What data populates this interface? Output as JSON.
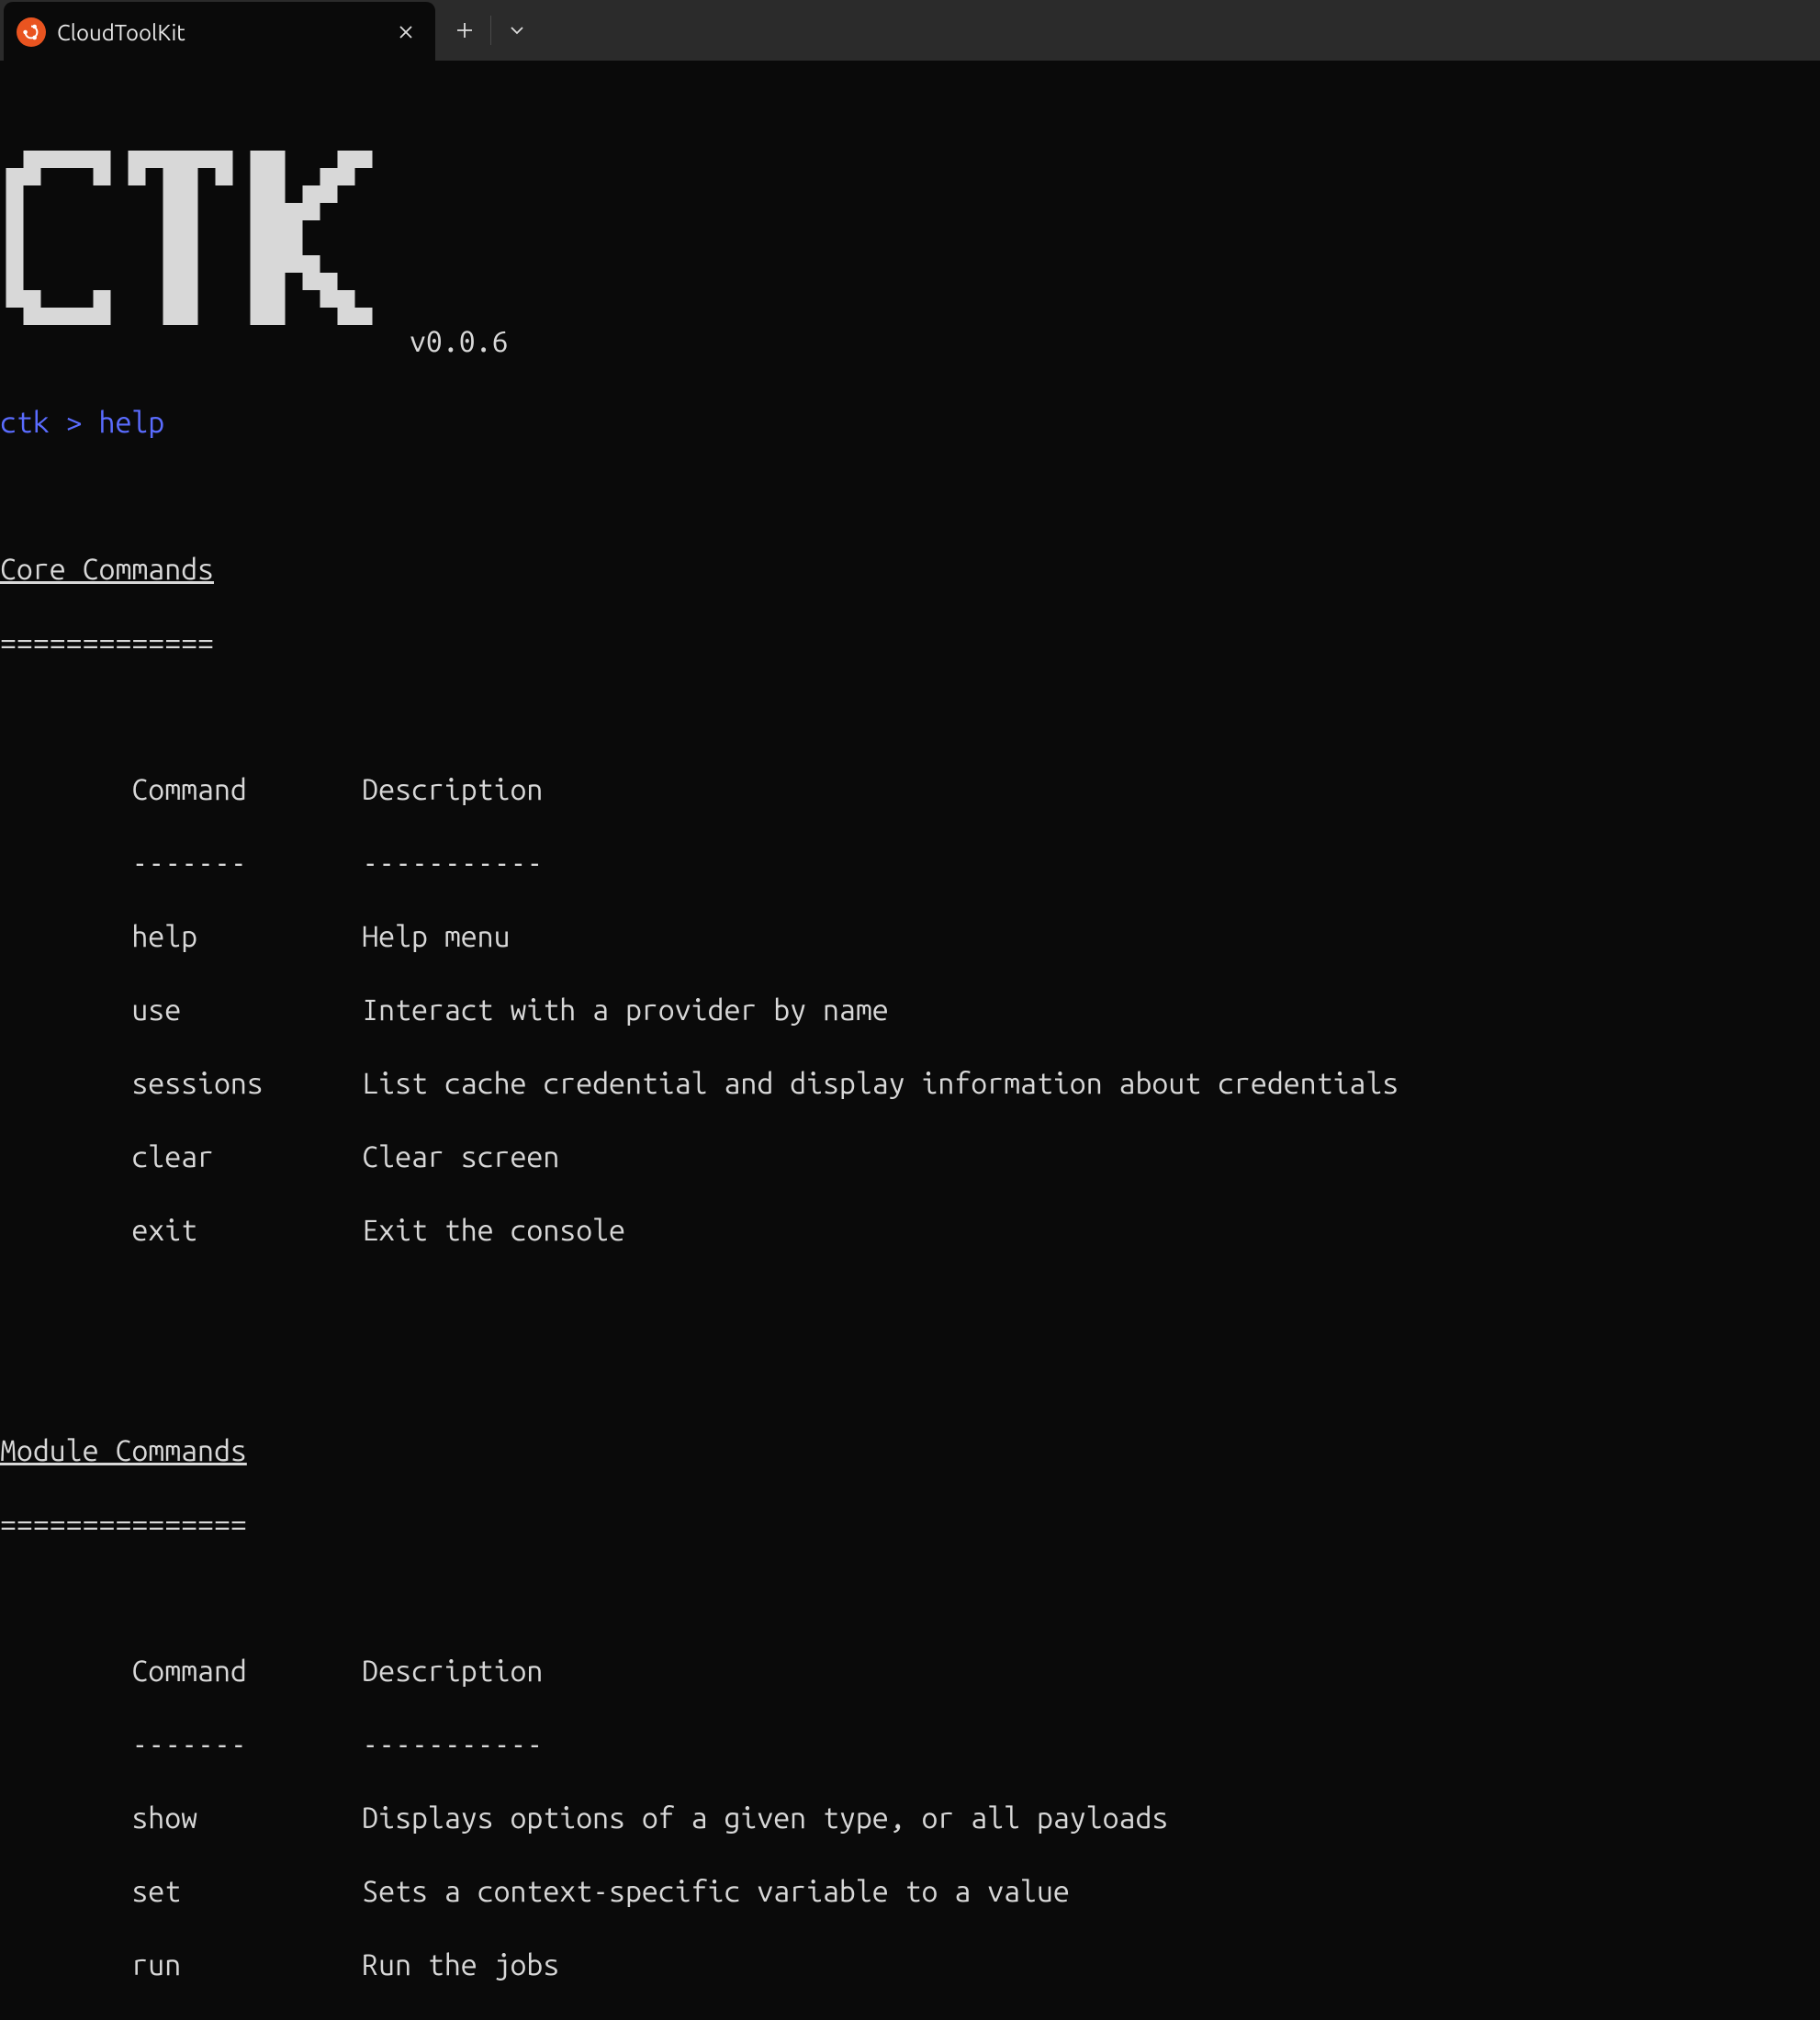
{
  "tab": {
    "title": "CloudToolKit"
  },
  "banner": {
    "ascii": " ██████╗████████╗██╗  ██╗\n██╔════╝╚══██╔══╝██║ ██╔╝\n██║        ██║   █████╔╝ \n██║        ██║   ██╔═██╗ \n╚██████╗   ██║   ██║  ██╗\n ╚═════╝   ╚═╝   ╚═╝  ╚═╝",
    "version": "v0.0.6"
  },
  "prompt": {
    "prefix": "ctk > ",
    "command": "help"
  },
  "sections": [
    {
      "title": "Core Commands",
      "underline": "=============",
      "header": {
        "col1": "Command",
        "col2": "Description",
        "u1": "-------",
        "u2": "-----------"
      },
      "rows": [
        {
          "cmd": "help",
          "desc": "Help menu"
        },
        {
          "cmd": "use",
          "desc": "Interact with a provider by name"
        },
        {
          "cmd": "sessions",
          "desc": "List cache credential and display information about credentials"
        },
        {
          "cmd": "clear",
          "desc": "Clear screen"
        },
        {
          "cmd": "exit",
          "desc": "Exit the console"
        }
      ]
    },
    {
      "title": "Module Commands",
      "underline": "===============",
      "header": {
        "col1": "Command",
        "col2": "Description",
        "u1": "-------",
        "u2": "-----------"
      },
      "rows": [
        {
          "cmd": "show",
          "desc": "Displays options of a given type, or all payloads"
        },
        {
          "cmd": "set",
          "desc": "Sets a context-specific variable to a value"
        },
        {
          "cmd": "run",
          "desc": "Run the jobs"
        }
      ]
    }
  ]
}
